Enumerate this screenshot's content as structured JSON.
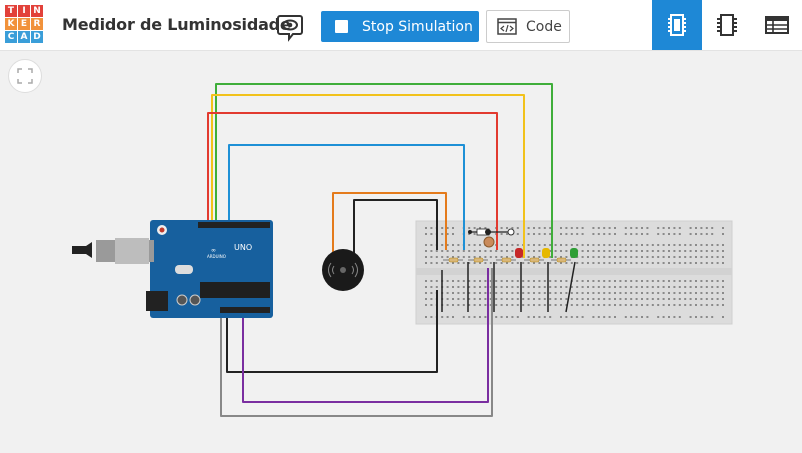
{
  "logo": {
    "letters": [
      "T",
      "I",
      "N",
      "K",
      "E",
      "R",
      "C",
      "A",
      "D"
    ],
    "colors": [
      "#e2413a",
      "#e2413a",
      "#e2413a",
      "#f1923b",
      "#f1923b",
      "#f1923b",
      "#3a9ed9",
      "#3a9ed9",
      "#3a9ed9"
    ]
  },
  "header": {
    "title": "Medidor de Luminosidade"
  },
  "toolbar": {
    "stop_label": "Stop Simulation",
    "code_label": "Code"
  },
  "board": {
    "model_label": "UNO",
    "brand_label": "ARDUINO"
  },
  "colors": {
    "accent": "#1e88d6",
    "canvas_bg": "#f1f1f1",
    "wire_green": "#3fae3a",
    "wire_yellow": "#f2c21b",
    "wire_red": "#e23a2f",
    "wire_blue": "#1e90d6",
    "wire_orange": "#e47b1c",
    "wire_black": "#222222",
    "wire_purple": "#7a2ea0",
    "wire_gray": "#888888"
  },
  "icons": {
    "share": "share-eye-icon",
    "stop": "stop-icon",
    "code": "code-icon",
    "circuit_view": "chip-icon",
    "schematic_view": "schematic-icon",
    "component_list": "list-icon",
    "fit": "fit-view-icon"
  }
}
